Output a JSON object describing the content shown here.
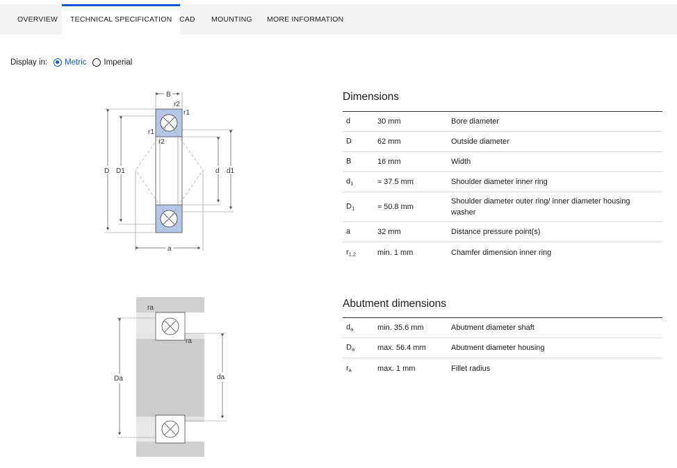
{
  "tabs": [
    {
      "label": "OVERVIEW",
      "active": false
    },
    {
      "label": "TECHNICAL SPECIFICATION",
      "active": true
    },
    {
      "label": "CAD",
      "active": false
    },
    {
      "label": "MOUNTING",
      "active": false
    },
    {
      "label": "MORE INFORMATION",
      "active": false
    }
  ],
  "display": {
    "label": "Display in:",
    "options": [
      {
        "label": "Metric",
        "selected": true
      },
      {
        "label": "Imperial",
        "selected": false
      }
    ]
  },
  "colors": {
    "accent": "#0f58d6",
    "bearing_fill": "#b4c7e7",
    "abutment_fill": "#d0d0d0"
  },
  "diagram1_labels": {
    "B": "B",
    "r2_top": "r2",
    "r1_top": "r1",
    "r1_left": "r1",
    "r2_inner": "r2",
    "D": "D",
    "D1": "D1",
    "d": "d",
    "d1": "d1",
    "a": "a"
  },
  "diagram2_labels": {
    "ra_top": "ra",
    "ra_inner": "ra",
    "Da": "Da",
    "da": "da"
  },
  "dimensions": {
    "title": "Dimensions",
    "rows": [
      {
        "symbol": "d",
        "sub": "",
        "value": "30 mm",
        "description": "Bore diameter"
      },
      {
        "symbol": "D",
        "sub": "",
        "value": "62 mm",
        "description": "Outside diameter"
      },
      {
        "symbol": "B",
        "sub": "",
        "value": "16 mm",
        "description": "Width"
      },
      {
        "symbol": "d",
        "sub": "1",
        "value": "≈ 37.5 mm",
        "description": "Shoulder diameter inner ring"
      },
      {
        "symbol": "D",
        "sub": "1",
        "value": "≈ 50.8 mm",
        "description": "Shoulder diameter outer ring/ inner diameter housing washer"
      },
      {
        "symbol": "a",
        "sub": "",
        "value": "32 mm",
        "description": "Distance pressure point(s)"
      },
      {
        "symbol": "r",
        "sub": "1,2",
        "value": "min. 1 mm",
        "description": "Chamfer dimension inner ring"
      }
    ]
  },
  "abutment": {
    "title": "Abutment dimensions",
    "rows": [
      {
        "symbol": "d",
        "sub": "a",
        "value": "min. 35.6 mm",
        "description": "Abutment diameter shaft"
      },
      {
        "symbol": "D",
        "sub": "a",
        "value": "max. 56.4 mm",
        "description": "Abutment diameter housing"
      },
      {
        "symbol": "r",
        "sub": "a",
        "value": "max. 1 mm",
        "description": "Fillet radius"
      }
    ]
  }
}
